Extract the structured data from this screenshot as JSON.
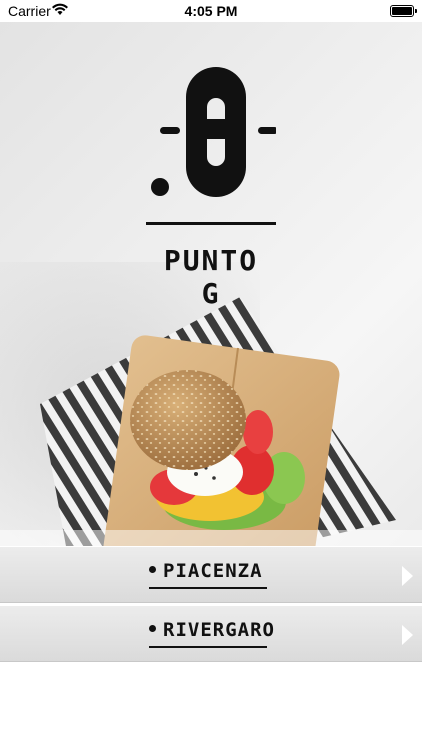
{
  "status_bar": {
    "carrier": "Carrier",
    "time": "4:05 PM"
  },
  "brand": {
    "name": "PUNTO G"
  },
  "locations": [
    {
      "label": "PIACENZA"
    },
    {
      "label": "RIVERGARO"
    }
  ],
  "icons": [
    "wifi-icon",
    "battery-icon",
    "logo-mark",
    "chevron-right-icon"
  ],
  "colors": {
    "text": "#111111",
    "row_bg": "#e3e3e3",
    "chevron": "#ffffff"
  }
}
